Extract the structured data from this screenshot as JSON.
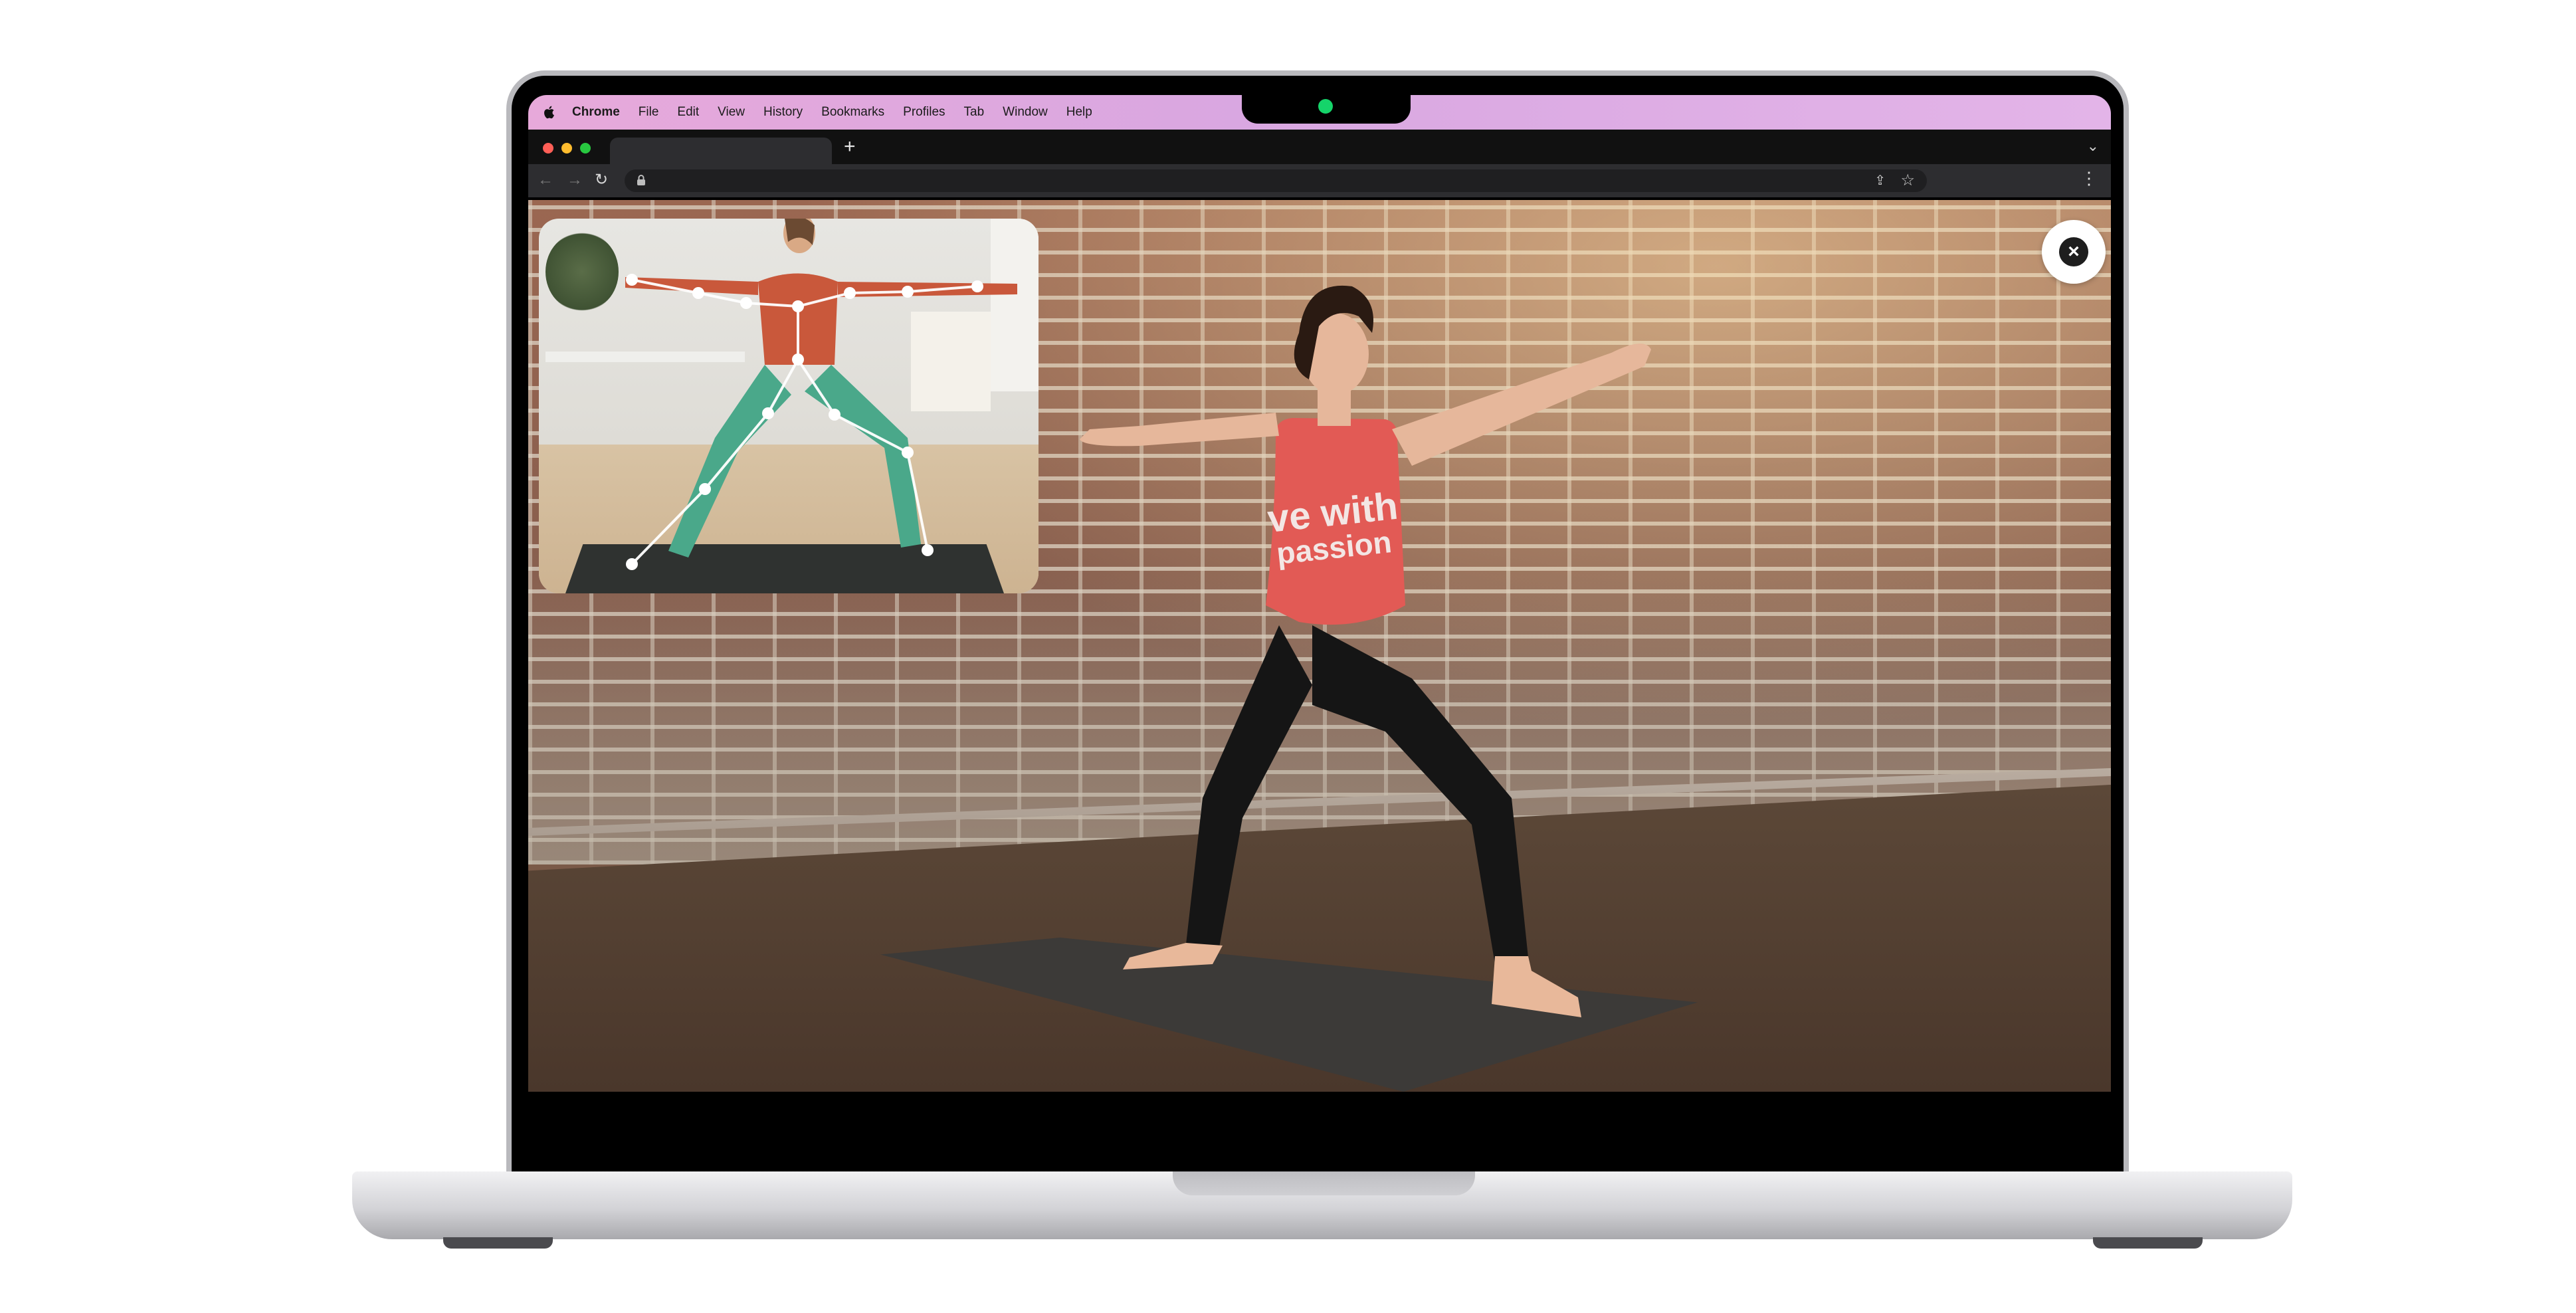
{
  "menubar": {
    "apple_icon": "apple-icon",
    "items": [
      "Chrome",
      "File",
      "Edit",
      "View",
      "History",
      "Bookmarks",
      "Profiles",
      "Tab",
      "Window",
      "Help"
    ]
  },
  "browser": {
    "new_tab_glyph": "+",
    "tab_menu_glyph": "⌄",
    "back_glyph": "←",
    "forward_glyph": "→",
    "reload_glyph": "↻",
    "lock_glyph": "🔒",
    "url": "",
    "share_glyph": "⇪",
    "star_glyph": "☆",
    "menu_glyph": "⋮"
  },
  "video": {
    "shirt_text": "ve with\npassion",
    "close_glyph": "×"
  },
  "colors": {
    "menubar": "#e3a8dc",
    "tank_top": "#e25a55",
    "camera_led": "#15d46a"
  }
}
